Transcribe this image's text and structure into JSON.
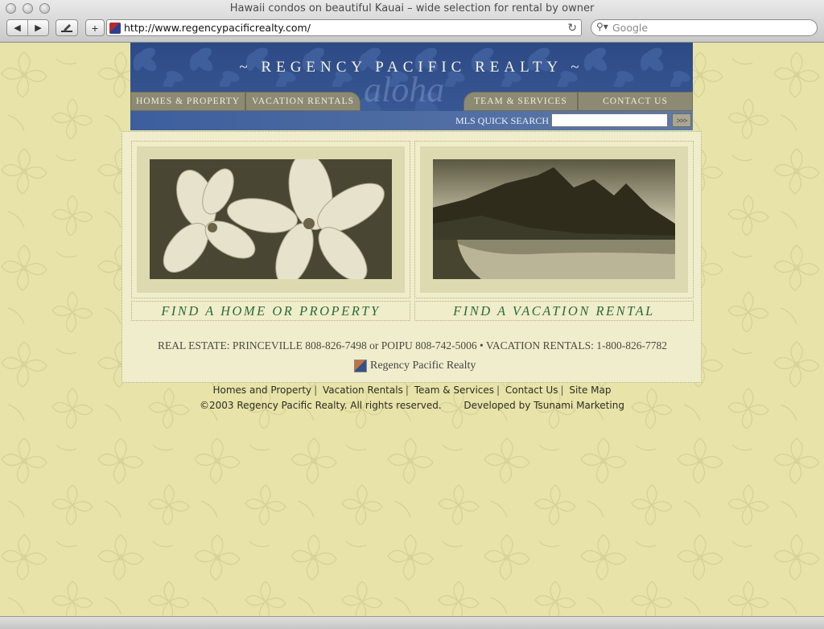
{
  "browser": {
    "window_title": "Hawaii condos on beautiful Kauai – wide selection for rental by owner",
    "url": "http://www.regencypacificrealty.com/",
    "search_placeholder": "Google",
    "add_label": "+"
  },
  "site": {
    "logo": "~ REGENCY PACIFIC REALTY ~",
    "watermark": "aloha",
    "nav": [
      {
        "label": "HOMES & PROPERTY"
      },
      {
        "label": "VACATION RENTALS"
      },
      {
        "label": "TEAM & SERVICES"
      },
      {
        "label": "CONTACT US"
      }
    ],
    "mls_label": "MLS QUICK SEARCH",
    "mls_value": "",
    "mls_go": ">>>",
    "panels": [
      {
        "caption": "FIND A HOME OR PROPERTY",
        "image": "plumeria flowers photo"
      },
      {
        "caption": "FIND A VACATION RENTAL",
        "image": "kauai coastline mountains photo"
      }
    ],
    "contact": {
      "re_label": "REAL ESTATE:",
      "re_text": "PRINCEVILLE 808-826-7498 or POIPU 808-742-5006 •",
      "vr_label": "VACATION RENTALS:",
      "vr_text": "1-800-826-7782"
    },
    "small_logo": "Regency Pacific Realty"
  },
  "footer": {
    "links": [
      "Homes and Property",
      "Vacation Rentals",
      "Team & Services",
      "Contact Us",
      "Site Map"
    ],
    "separator": "|",
    "copyright": "©2003 Regency Pacific Realty. All rights reserved.",
    "developer": "Developed by Tsunami Marketing"
  },
  "colors": {
    "page_bg": "#e7e3a9",
    "header_blue": "#2d4a86",
    "caption_green": "#2b6b3b",
    "tab_gray": "#8d8a74"
  }
}
